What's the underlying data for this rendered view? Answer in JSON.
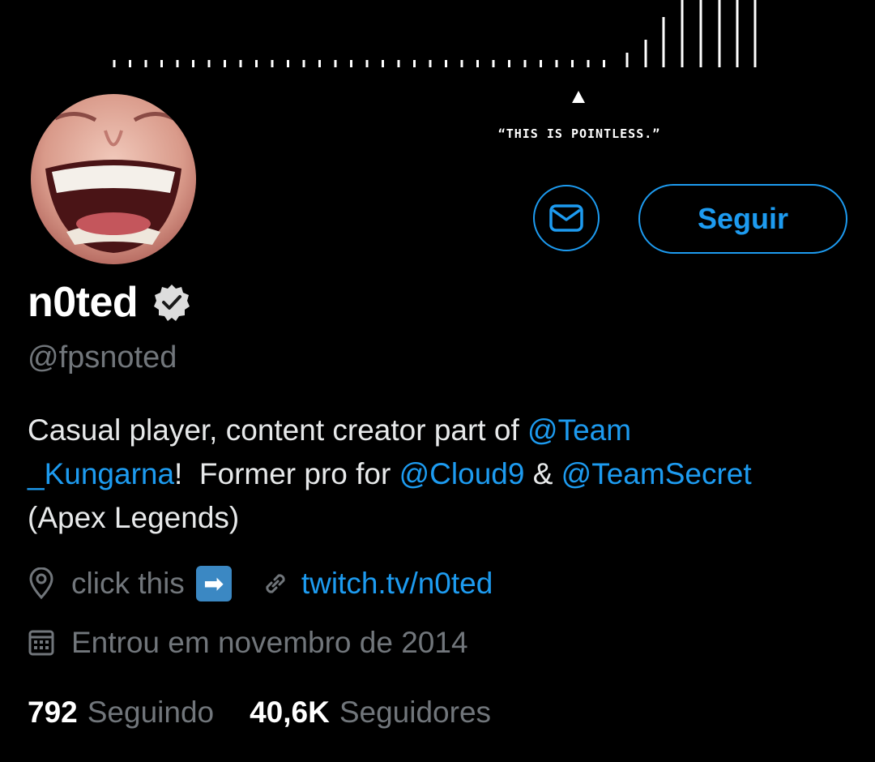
{
  "banner": {
    "quote": "“THIS IS POINTLESS.”"
  },
  "profile": {
    "display_name": "n0ted",
    "handle": "@fpsnoted",
    "verified": true,
    "follow_label": "Seguir",
    "dm_icon": "mail-icon"
  },
  "bio": {
    "line1_text": "Casual player, content creator part of ",
    "line1_mention": "@Team",
    "line2_mention_cont": "_Kungarna",
    "line2_text_a": "!  Former pro for ",
    "line2_mention_b": "@Cloud9",
    "line2_text_b": " & ",
    "line2_mention_c": "@TeamSecret",
    "line3_text": "(Apex Legends)"
  },
  "meta": {
    "location": "click this",
    "location_emoji": "➡",
    "website": "twitch.tv/n0ted",
    "joined": "Entrou em novembro de 2014"
  },
  "stats": {
    "following_count": "792",
    "following_label": "Seguindo",
    "followers_count": "40,6K",
    "followers_label": "Seguidores"
  },
  "colors": {
    "background": "#000000",
    "accent": "#1d9bf0",
    "muted": "#71767b",
    "text": "#e7e9ea"
  }
}
